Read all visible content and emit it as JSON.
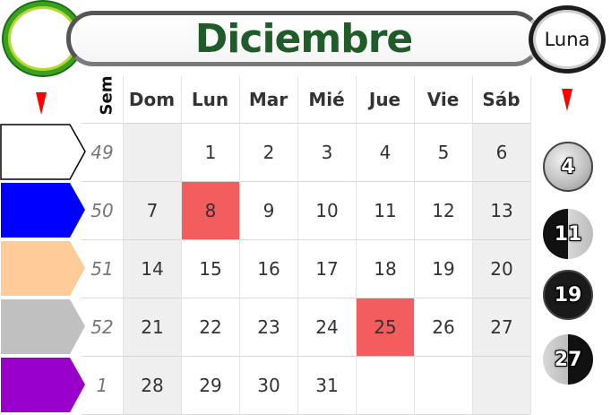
{
  "header": {
    "month": "Diciembre",
    "moon_title": "Luna"
  },
  "grid": {
    "week_column_label": "Sem",
    "day_headers": [
      "Dom",
      "Lun",
      "Mar",
      "Mié",
      "Jue",
      "Vie",
      "Sáb"
    ],
    "weeks": [
      {
        "number": "49",
        "days": [
          "",
          "1",
          "2",
          "3",
          "4",
          "5",
          "6"
        ]
      },
      {
        "number": "50",
        "days": [
          "7",
          "8",
          "9",
          "10",
          "11",
          "12",
          "13"
        ]
      },
      {
        "number": "51",
        "days": [
          "14",
          "15",
          "16",
          "17",
          "18",
          "19",
          "20"
        ]
      },
      {
        "number": "52",
        "days": [
          "21",
          "22",
          "23",
          "24",
          "25",
          "26",
          "27"
        ]
      },
      {
        "number": "1",
        "days": [
          "28",
          "29",
          "30",
          "31",
          "",
          "",
          ""
        ]
      }
    ],
    "highlighted_days": [
      "8",
      "25"
    ],
    "highlight_color": "#f45d5d",
    "weekend_color": "#efefef"
  },
  "week_tabs": [
    {
      "color": "#ffffff"
    },
    {
      "color": "#0000ff"
    },
    {
      "color": "#ffcc99"
    },
    {
      "color": "#c0c0c0"
    },
    {
      "color": "#9900cc"
    }
  ],
  "moon_phases": [
    {
      "day": "4",
      "phase": "full-moon"
    },
    {
      "day": "11",
      "phase": "last-quarter"
    },
    {
      "day": "19",
      "phase": "new-moon"
    },
    {
      "day": "27",
      "phase": "first-quarter"
    }
  ],
  "colors": {
    "title_green": "#1f5c2a",
    "marker_red": "#ff0000"
  }
}
